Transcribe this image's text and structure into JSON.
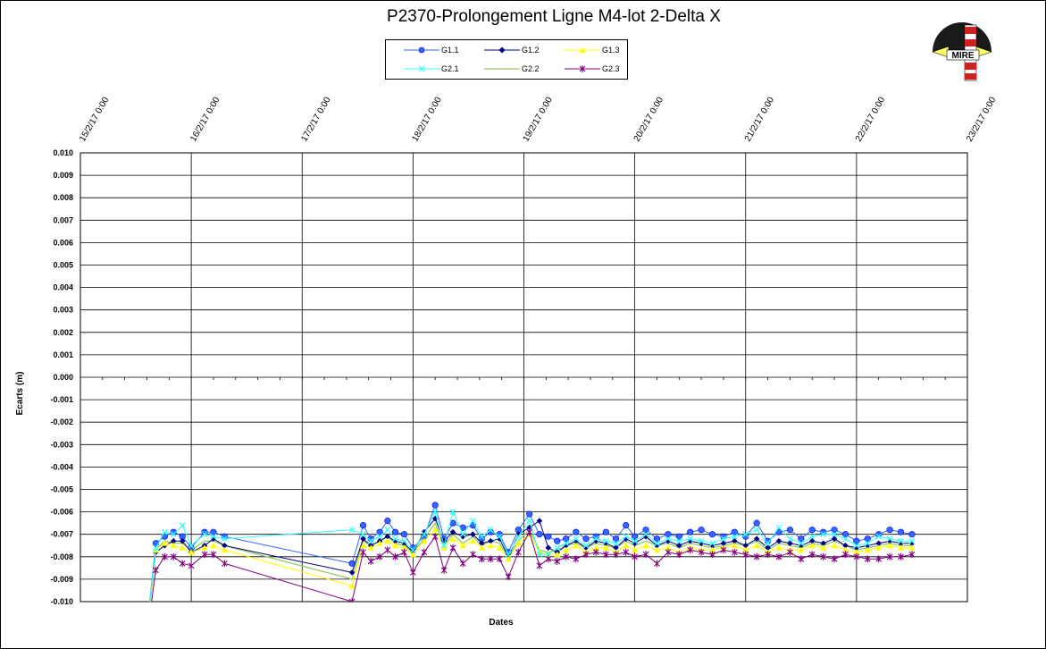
{
  "chart_data": {
    "type": "line",
    "title": "P2370-Prolongement  Ligne  M4-lot 2-Delta  X",
    "xlabel": "Dates",
    "ylabel": "Ecarts (m)",
    "ylim": [
      -0.01,
      0.01
    ],
    "y_ticks": [
      "0.010",
      "0.009",
      "0.008",
      "0.007",
      "0.006",
      "0.005",
      "0.004",
      "0.003",
      "0.002",
      "0.001",
      "0.000",
      "-0.001",
      "-0.002",
      "-0.003",
      "-0.004",
      "-0.005",
      "-0.006",
      "-0.007",
      "-0.008",
      "-0.009",
      "-0.010"
    ],
    "x_ticks": [
      "15/2/17 0:00",
      "16/2/17 0:00",
      "17/2/17 0:00",
      "18/2/17 0:00",
      "19/2/17 0:00",
      "20/2/17 0:00",
      "21/2/17 0:00",
      "22/2/17 0:00",
      "23/2/17 0:00"
    ],
    "x_start_label": "15/2/17 0:00",
    "grid": true,
    "legend_position": "top-center",
    "series": [
      {
        "name": "G1.1",
        "color": "#3366ff",
        "marker": "circle",
        "x": [
          15.6,
          15.68,
          15.76,
          15.84,
          15.92,
          16.0,
          16.12,
          16.2,
          16.3,
          17.45,
          17.55,
          17.62,
          17.7,
          17.77,
          17.84,
          17.92,
          18.0,
          18.1,
          18.2,
          18.28,
          18.36,
          18.45,
          18.54,
          18.62,
          18.7,
          18.78,
          18.86,
          18.95,
          19.05,
          19.14,
          19.22,
          19.3,
          19.38,
          19.47,
          19.56,
          19.65,
          19.74,
          19.83,
          19.92,
          20.0,
          20.1,
          20.2,
          20.3,
          20.4,
          20.5,
          20.6,
          20.7,
          20.8,
          20.9,
          21.0,
          21.1,
          21.2,
          21.3,
          21.4,
          21.5,
          21.6,
          21.7,
          21.8,
          21.9,
          22.0,
          22.1,
          22.2,
          22.3,
          22.4,
          22.5
        ],
        "y": [
          -0.0112,
          -0.0074,
          -0.0071,
          -0.0069,
          -0.0071,
          -0.0076,
          -0.0069,
          -0.0069,
          -0.0071,
          -0.0083,
          -0.0066,
          -0.0072,
          -0.0069,
          -0.0064,
          -0.0069,
          -0.007,
          -0.0076,
          -0.0071,
          -0.0057,
          -0.0072,
          -0.0065,
          -0.0067,
          -0.0066,
          -0.0072,
          -0.0069,
          -0.007,
          -0.0078,
          -0.0068,
          -0.0061,
          -0.007,
          -0.0071,
          -0.0073,
          -0.0072,
          -0.0069,
          -0.0072,
          -0.0071,
          -0.0069,
          -0.0072,
          -0.0066,
          -0.0071,
          -0.0068,
          -0.0072,
          -0.007,
          -0.0071,
          -0.0069,
          -0.0068,
          -0.007,
          -0.0071,
          -0.0069,
          -0.0071,
          -0.0065,
          -0.0073,
          -0.0069,
          -0.0068,
          -0.0072,
          -0.0068,
          -0.0069,
          -0.0068,
          -0.007,
          -0.0073,
          -0.0072,
          -0.007,
          -0.0068,
          -0.0069,
          -0.007
        ]
      },
      {
        "name": "G1.2",
        "color": "#000080",
        "marker": "diamond",
        "x": [
          15.6,
          15.68,
          15.76,
          15.84,
          15.92,
          16.0,
          16.12,
          16.2,
          16.3,
          17.45,
          17.55,
          17.62,
          17.7,
          17.77,
          17.84,
          17.92,
          18.0,
          18.1,
          18.2,
          18.28,
          18.36,
          18.45,
          18.54,
          18.62,
          18.7,
          18.78,
          18.86,
          18.95,
          19.05,
          19.14,
          19.22,
          19.3,
          19.38,
          19.47,
          19.56,
          19.65,
          19.74,
          19.83,
          19.92,
          20.0,
          20.1,
          20.2,
          20.3,
          20.4,
          20.5,
          20.6,
          20.7,
          20.8,
          20.9,
          21.0,
          21.1,
          21.2,
          21.3,
          21.4,
          21.5,
          21.6,
          21.7,
          21.8,
          21.9,
          22.0,
          22.1,
          22.2,
          22.3,
          22.4,
          22.5
        ],
        "y": [
          -0.0113,
          -0.0078,
          -0.0075,
          -0.0073,
          -0.0073,
          -0.0078,
          -0.0075,
          -0.0072,
          -0.0075,
          -0.0087,
          -0.0072,
          -0.0075,
          -0.0073,
          -0.0071,
          -0.0073,
          -0.0074,
          -0.0078,
          -0.0069,
          -0.0063,
          -0.0073,
          -0.0069,
          -0.0071,
          -0.007,
          -0.0074,
          -0.0073,
          -0.0072,
          -0.008,
          -0.007,
          -0.0067,
          -0.0064,
          -0.0076,
          -0.0078,
          -0.0075,
          -0.0073,
          -0.0076,
          -0.0073,
          -0.0074,
          -0.0076,
          -0.0072,
          -0.0074,
          -0.0071,
          -0.0075,
          -0.0073,
          -0.0075,
          -0.0073,
          -0.0074,
          -0.0075,
          -0.0074,
          -0.0073,
          -0.0075,
          -0.0072,
          -0.0076,
          -0.0073,
          -0.0074,
          -0.0075,
          -0.0073,
          -0.0074,
          -0.0072,
          -0.0075,
          -0.0076,
          -0.0075,
          -0.0074,
          -0.0073,
          -0.0074,
          -0.0074
        ]
      },
      {
        "name": "G1.3",
        "color": "#ffff00",
        "marker": "triangle",
        "x": [
          15.6,
          15.68,
          15.76,
          15.84,
          15.92,
          16.0,
          16.12,
          16.2,
          16.3,
          17.45,
          17.55,
          17.62,
          17.7,
          17.77,
          17.84,
          17.92,
          18.0,
          18.1,
          18.2,
          18.28,
          18.36,
          18.45,
          18.54,
          18.62,
          18.7,
          18.78,
          18.86,
          18.95,
          19.05,
          19.14,
          19.22,
          19.3,
          19.38,
          19.47,
          19.56,
          19.65,
          19.74,
          19.83,
          19.92,
          20.0,
          20.1,
          20.2,
          20.3,
          20.4,
          20.5,
          20.6,
          20.7,
          20.8,
          20.9,
          21.0,
          21.1,
          21.2,
          21.3,
          21.4,
          21.5,
          21.6,
          21.7,
          21.8,
          21.9,
          22.0,
          22.1,
          22.2,
          22.3,
          22.4,
          22.5
        ],
        "y": [
          -0.0114,
          -0.0077,
          -0.0074,
          -0.0075,
          -0.0076,
          -0.0078,
          -0.0076,
          -0.0075,
          -0.0077,
          -0.0093,
          -0.0075,
          -0.0076,
          -0.0074,
          -0.0073,
          -0.0075,
          -0.0076,
          -0.0079,
          -0.0073,
          -0.0068,
          -0.0076,
          -0.0072,
          -0.0075,
          -0.0073,
          -0.0076,
          -0.0075,
          -0.0076,
          -0.0081,
          -0.0074,
          -0.007,
          -0.0078,
          -0.0079,
          -0.0079,
          -0.0077,
          -0.0075,
          -0.0078,
          -0.0076,
          -0.0076,
          -0.0078,
          -0.0075,
          -0.0077,
          -0.0075,
          -0.0077,
          -0.0076,
          -0.0078,
          -0.0076,
          -0.0077,
          -0.0077,
          -0.0076,
          -0.0075,
          -0.0077,
          -0.0075,
          -0.0078,
          -0.0076,
          -0.0077,
          -0.0077,
          -0.0075,
          -0.0076,
          -0.0075,
          -0.0077,
          -0.0078,
          -0.0077,
          -0.0076,
          -0.0075,
          -0.0076,
          -0.0076
        ]
      },
      {
        "name": "G2.1",
        "color": "#33ffff",
        "marker": "x",
        "x": [
          15.6,
          15.68,
          15.76,
          15.84,
          15.92,
          16.0,
          16.12,
          16.2,
          16.3,
          17.45,
          17.55,
          17.62,
          17.7,
          17.77,
          17.84,
          17.92,
          18.0,
          18.1,
          18.2,
          18.28,
          18.36,
          18.45,
          18.54,
          18.62,
          18.7,
          18.78,
          18.86,
          18.95,
          19.05,
          19.14,
          19.22,
          19.3,
          19.38,
          19.47,
          19.56,
          19.65,
          19.74,
          19.83,
          19.92,
          20.0,
          20.1,
          20.2,
          20.3,
          20.4,
          20.5,
          20.6,
          20.7,
          20.8,
          20.9,
          21.0,
          21.1,
          21.2,
          21.3,
          21.4,
          21.5,
          21.6,
          21.7,
          21.8,
          21.9,
          22.0,
          22.1,
          22.2,
          22.3,
          22.4,
          22.5
        ],
        "y": [
          -0.0112,
          -0.0076,
          -0.0069,
          -0.007,
          -0.0066,
          -0.0075,
          -0.007,
          -0.0071,
          -0.0072,
          -0.0068,
          -0.007,
          -0.0073,
          -0.0071,
          -0.0068,
          -0.0072,
          -0.0073,
          -0.0077,
          -0.007,
          -0.006,
          -0.0075,
          -0.006,
          -0.007,
          -0.0064,
          -0.0071,
          -0.0068,
          -0.0071,
          -0.0079,
          -0.0071,
          -0.0064,
          -0.0079,
          -0.0079,
          -0.0076,
          -0.0074,
          -0.0072,
          -0.0075,
          -0.0072,
          -0.0073,
          -0.0074,
          -0.0071,
          -0.0073,
          -0.007,
          -0.0074,
          -0.0072,
          -0.0073,
          -0.0072,
          -0.0073,
          -0.0074,
          -0.0072,
          -0.0071,
          -0.007,
          -0.0068,
          -0.0074,
          -0.0067,
          -0.0072,
          -0.0074,
          -0.0071,
          -0.007,
          -0.007,
          -0.0072,
          -0.0075,
          -0.0074,
          -0.0071,
          -0.0072,
          -0.0073,
          -0.0073
        ]
      },
      {
        "name": "G2.2",
        "color": "#99cc66",
        "marker": "none",
        "x": [
          15.6,
          15.68,
          15.76,
          15.84,
          15.92,
          16.0,
          16.12,
          16.2,
          16.3,
          17.45,
          17.55,
          17.62,
          17.7,
          17.77,
          17.84,
          17.92,
          18.0,
          18.1,
          18.2,
          18.28,
          18.36,
          18.45,
          18.54,
          18.62,
          18.7,
          18.78,
          18.86,
          18.95,
          19.05,
          19.14,
          19.22,
          19.3,
          19.38,
          19.47,
          19.56,
          19.65,
          19.74,
          19.83,
          19.92,
          20.0,
          20.1,
          20.2,
          20.3,
          20.4,
          20.5,
          20.6,
          20.7,
          20.8,
          20.9,
          21.0,
          21.1,
          21.2,
          21.3,
          21.4,
          21.5,
          21.6,
          21.7,
          21.8,
          21.9,
          22.0,
          22.1,
          22.2,
          22.3,
          22.4,
          22.5
        ],
        "y": [
          -0.0113,
          -0.0077,
          -0.0073,
          -0.0074,
          -0.0074,
          -0.0077,
          -0.0073,
          -0.0073,
          -0.0075,
          -0.009,
          -0.0073,
          -0.0075,
          -0.0073,
          -0.0071,
          -0.0074,
          -0.0075,
          -0.0078,
          -0.0072,
          -0.0065,
          -0.0075,
          -0.007,
          -0.0074,
          -0.0071,
          -0.0075,
          -0.0073,
          -0.0074,
          -0.008,
          -0.0073,
          -0.0068,
          -0.0077,
          -0.0078,
          -0.0077,
          -0.0075,
          -0.0074,
          -0.0076,
          -0.0074,
          -0.0075,
          -0.0076,
          -0.0073,
          -0.0075,
          -0.0073,
          -0.0075,
          -0.0074,
          -0.0076,
          -0.0074,
          -0.0075,
          -0.0076,
          -0.0075,
          -0.0074,
          -0.0075,
          -0.0073,
          -0.0077,
          -0.0074,
          -0.0075,
          -0.0076,
          -0.0074,
          -0.0075,
          -0.0073,
          -0.0075,
          -0.0077,
          -0.0076,
          -0.0075,
          -0.0074,
          -0.0075,
          -0.0075
        ]
      },
      {
        "name": "G2.3",
        "color": "#800080",
        "marker": "star",
        "x": [
          15.6,
          15.68,
          15.76,
          15.84,
          15.92,
          16.0,
          16.12,
          16.2,
          16.3,
          17.45,
          17.55,
          17.62,
          17.7,
          17.77,
          17.84,
          17.92,
          18.0,
          18.1,
          18.2,
          18.28,
          18.36,
          18.45,
          18.54,
          18.62,
          18.7,
          18.78,
          18.86,
          18.95,
          19.05,
          19.14,
          19.22,
          19.3,
          19.38,
          19.47,
          19.56,
          19.65,
          19.74,
          19.83,
          19.92,
          20.0,
          20.1,
          20.2,
          20.3,
          20.4,
          20.5,
          20.6,
          20.7,
          20.8,
          20.9,
          21.0,
          21.1,
          21.2,
          21.3,
          21.4,
          21.5,
          21.6,
          21.7,
          21.8,
          21.9,
          22.0,
          22.1,
          22.2,
          22.3,
          22.4,
          22.5
        ],
        "y": [
          -0.0115,
          -0.0086,
          -0.008,
          -0.008,
          -0.0083,
          -0.0084,
          -0.0079,
          -0.0079,
          -0.0083,
          -0.01,
          -0.0078,
          -0.0082,
          -0.008,
          -0.0077,
          -0.008,
          -0.0078,
          -0.0087,
          -0.0078,
          -0.0071,
          -0.0086,
          -0.0076,
          -0.0083,
          -0.0079,
          -0.0081,
          -0.0081,
          -0.0081,
          -0.0089,
          -0.0078,
          -0.0069,
          -0.0084,
          -0.0081,
          -0.0082,
          -0.008,
          -0.0081,
          -0.0079,
          -0.0078,
          -0.0079,
          -0.0079,
          -0.0078,
          -0.008,
          -0.0079,
          -0.0083,
          -0.0078,
          -0.0079,
          -0.0077,
          -0.0078,
          -0.0079,
          -0.0077,
          -0.0078,
          -0.0079,
          -0.008,
          -0.0079,
          -0.008,
          -0.0078,
          -0.0081,
          -0.0079,
          -0.008,
          -0.0081,
          -0.0079,
          -0.008,
          -0.0081,
          -0.0081,
          -0.008,
          -0.008,
          -0.0079
        ]
      }
    ]
  },
  "logo": {
    "text": "MIRE"
  }
}
